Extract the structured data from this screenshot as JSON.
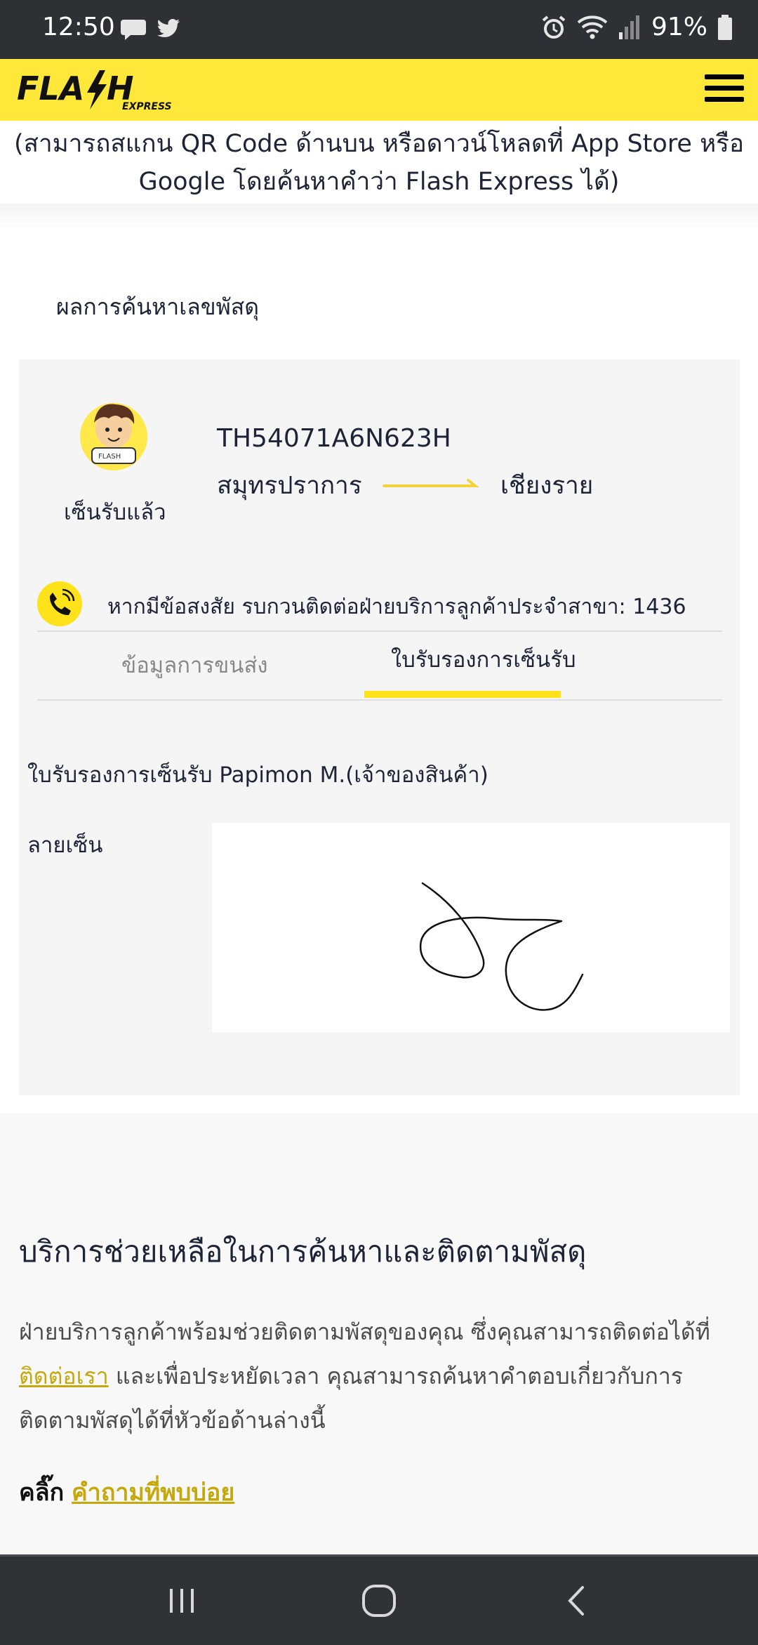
{
  "status_bar": {
    "time": "12:50",
    "battery": "91%",
    "icons": [
      "message-icon",
      "twitter-icon",
      "alarm-icon",
      "wifi-icon",
      "signal-icon",
      "battery-icon"
    ]
  },
  "header": {
    "logo_text": "FLASH",
    "logo_sub": "EXPRESS",
    "menu_icon": "hamburger-icon",
    "brand_color": "#ffe83a"
  },
  "intro": {
    "app_note": "(สามารถสแกน QR Code ด้านบน หรือดาวน์โหลดที่ App Store หรือ Google โดยค้นหาคำว่า Flash Express ได้)"
  },
  "results": {
    "title": "ผลการค้นหาเลขพัสดุ",
    "status_label": "เซ็นรับแล้ว",
    "tracking_number": "TH54071A6N623H",
    "origin": "สมุทรปราการ",
    "destination": "เชียงราย",
    "contact_text": "หากมีข้อสงสัย รบกวนติดต่อฝ่ายบริการลูกค้าประจำสาขา: 1436",
    "tabs": [
      {
        "label": "ข้อมูลการขนส่ง",
        "active": false
      },
      {
        "label": "ใบรับรองการเซ็นรับ",
        "active": true
      }
    ],
    "receipt_title": "ใบรับรองการเซ็นรับ Papimon M.(เจ้าของสินค้า)",
    "signature_label": "ลายเซ็น"
  },
  "help": {
    "title": "บริการช่วยเหลือในการค้นหาและติดตามพัสดุ",
    "text_before": "ฝ่ายบริการลูกค้าพร้อมช่วยติดตามพัสดุของคุณ ซึ่งคุณสามารถติดต่อได้ที่ ",
    "contact_link": "ติดต่อเรา",
    "text_after": " และเพื่อประหยัดเวลา คุณสามารถค้นหาคำตอบเกี่ยวกับการติดตามพัสดุได้ที่หัวข้อด้านล่างนี้",
    "click_label": "คลิ๊ก",
    "faq_link": "คำถามที่พบบ่อย"
  },
  "nav_bar": {
    "buttons": [
      "recent-apps-icon",
      "home-icon",
      "back-icon"
    ]
  }
}
